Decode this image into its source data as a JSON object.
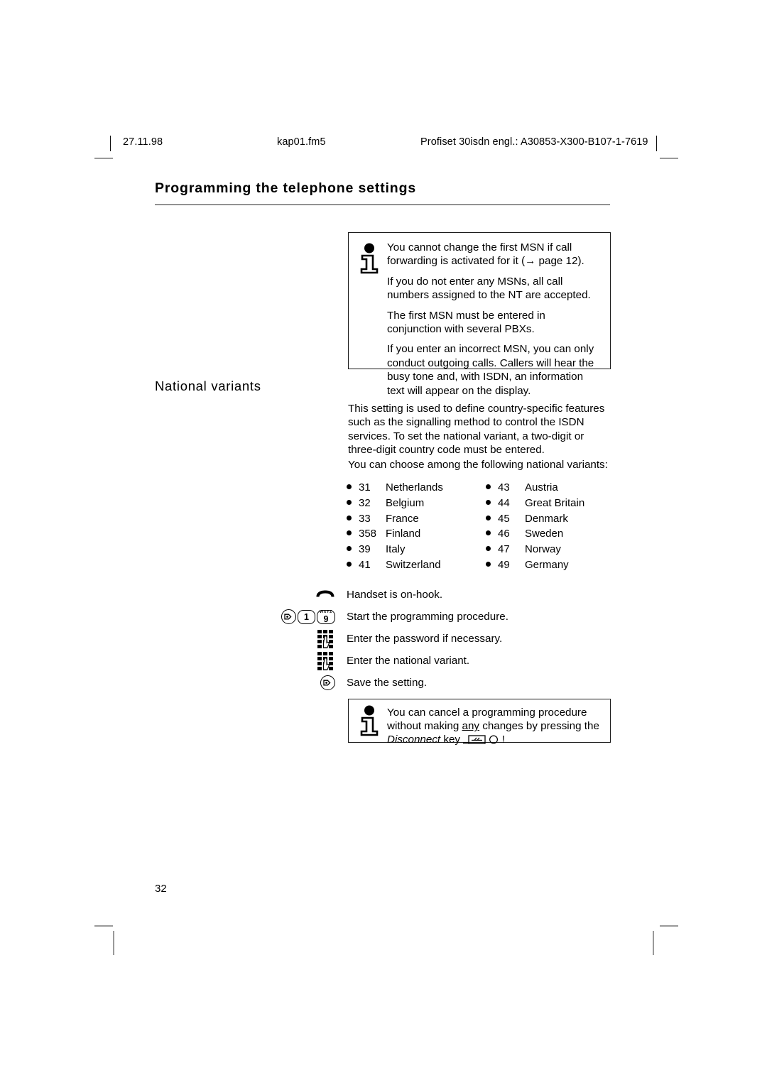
{
  "header": {
    "date": "27.11.98",
    "file": "kap01.fm5",
    "document": "Profiset 30isdn engl.: A30853-X300-B107-1-7619"
  },
  "page_title": "Programming the telephone settings",
  "note_msn": {
    "icon": "info-icon",
    "paragraphs": [
      "You cannot change the first MSN if call forwarding is activated for it (→ page 12).",
      "If you do not enter any MSNs, all call numbers assigned to the NT are accepted.",
      "The first MSN must be entered in conjunction with several PBXs.",
      "If you enter an incorrect MSN, you can only conduct outgoing calls. Callers will hear the busy tone and, with ISDN, an information text will appear on the display."
    ]
  },
  "section": {
    "heading": "National variants",
    "intro": "This setting is used to define country-specific features such as the signalling method to control the ISDN services. To set the national variant, a two-digit or three-digit country code must be entered.",
    "choose": "You can choose among the following national variants:"
  },
  "variants": {
    "left": [
      {
        "code": "31",
        "country": "Netherlands"
      },
      {
        "code": "32",
        "country": "Belgium"
      },
      {
        "code": "33",
        "country": "France"
      },
      {
        "code": "358",
        "country": "Finland"
      },
      {
        "code": "39",
        "country": "Italy"
      },
      {
        "code": "41",
        "country": "Switzerland"
      }
    ],
    "right": [
      {
        "code": "43",
        "country": "Austria"
      },
      {
        "code": "44",
        "country": "Great Britain"
      },
      {
        "code": "45",
        "country": "Denmark"
      },
      {
        "code": "46",
        "country": "Sweden"
      },
      {
        "code": "47",
        "country": "Norway"
      },
      {
        "code": "49",
        "country": "Germany"
      }
    ]
  },
  "steps": [
    {
      "icons": "handset-on-hook-icon",
      "text": "Handset is on-hook."
    },
    {
      "icons": "set-key-then-1-then-9",
      "text": "Start the programming procedure.",
      "key1": "1",
      "key2": "9",
      "key2_sub": "WXYZ"
    },
    {
      "icons": "keypad-icon",
      "text": "Enter the password if necessary."
    },
    {
      "icons": "keypad-icon",
      "text": "Enter the national variant."
    },
    {
      "icons": "set-key-icon",
      "text": "Save the setting."
    }
  ],
  "note_cancel": {
    "icon": "info-icon",
    "line1": "You can cancel a programming procedure",
    "line2_a": "without making ",
    "line2_underlined": "any",
    "line2_b": " changes by pressing the",
    "line3_italic": "Disconnect",
    "line3_rest": "key",
    "line3_end": "!"
  },
  "page_number": "32"
}
